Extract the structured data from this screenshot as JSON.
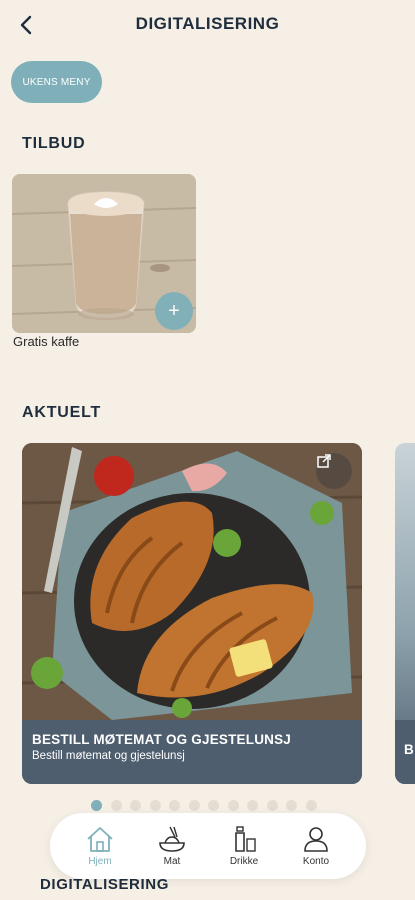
{
  "header": {
    "title": "DIGITALISERING"
  },
  "menu_pill": {
    "label": "UKENS MENY"
  },
  "offers": {
    "title": "TILBUD",
    "items": [
      {
        "label": "Gratis kaffe",
        "add_label": "+"
      }
    ]
  },
  "news": {
    "title": "AKTUELT",
    "cards": [
      {
        "title": "BESTILL MØTEMAT OG GJESTELUNSJ",
        "subtitle": "Bestill møtemat og gjestelunsj"
      },
      {
        "title": "B"
      }
    ],
    "pager": {
      "count": 12,
      "active": 0
    }
  },
  "section_below": {
    "title": "DIGITALISERING"
  },
  "tabbar": {
    "items": [
      {
        "label": "Hjem",
        "icon": "home-icon",
        "active": true
      },
      {
        "label": "Mat",
        "icon": "food-icon",
        "active": false
      },
      {
        "label": "Drikke",
        "icon": "drink-icon",
        "active": false
      },
      {
        "label": "Konto",
        "icon": "account-icon",
        "active": false
      }
    ]
  },
  "colors": {
    "background": "#f5efe5",
    "accent": "#7fb0ba",
    "caption": "#4e5e6e",
    "text": "#1f2d3d"
  }
}
